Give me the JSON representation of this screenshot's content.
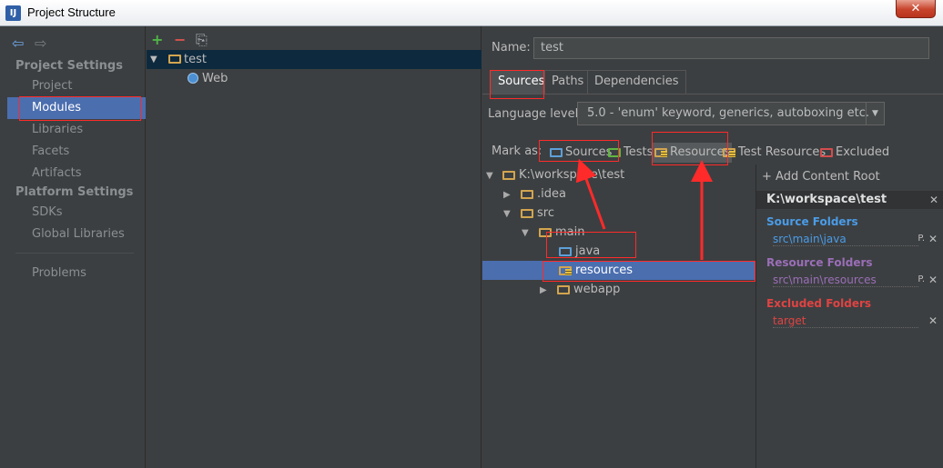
{
  "window": {
    "title": "Project Structure",
    "close_label": "✕"
  },
  "nav": {
    "project_settings": "Project Settings",
    "project_items": [
      "Project",
      "Modules",
      "Libraries",
      "Facets",
      "Artifacts"
    ],
    "platform_settings": "Platform Settings",
    "platform_items": [
      "SDKs",
      "Global Libraries"
    ],
    "problems": "Problems"
  },
  "modules": {
    "toolbar": {
      "add": "+",
      "remove": "−",
      "copy": "⎘"
    },
    "tree": [
      {
        "label": "test"
      },
      {
        "label": "Web"
      }
    ]
  },
  "module_settings": {
    "name_label": "Name:",
    "name_value": "test",
    "tabs": [
      "Sources",
      "Paths",
      "Dependencies"
    ],
    "language_level_label": "Language level:",
    "language_level_value": "5.0 - 'enum' keyword, generics, autoboxing etc.",
    "mark_as_label": "Mark as:",
    "mark_as": [
      "Sources",
      "Tests",
      "Resources",
      "Test Resources",
      "Excluded"
    ]
  },
  "file_tree": [
    {
      "label": "K:\\workspace\\test"
    },
    {
      "label": ".idea"
    },
    {
      "label": "src"
    },
    {
      "label": "main"
    },
    {
      "label": "java"
    },
    {
      "label": "resources"
    },
    {
      "label": "webapp"
    }
  ],
  "content_roots": {
    "add_label": "Add Content Root",
    "root": "K:\\workspace\\test",
    "source_title": "Source Folders",
    "source_path": "src\\main\\java",
    "resource_title": "Resource Folders",
    "resource_path": "src\\main\\resources",
    "excluded_title": "Excluded Folders",
    "excluded_path": "target",
    "p_label": "P.",
    "x_label": "✕"
  },
  "colors": {
    "source": "#4a9ce8",
    "resource": "#9a6eb7",
    "excluded": "#e04343",
    "selection": "#4b6eaf",
    "annotation": "#ff2a2a"
  }
}
